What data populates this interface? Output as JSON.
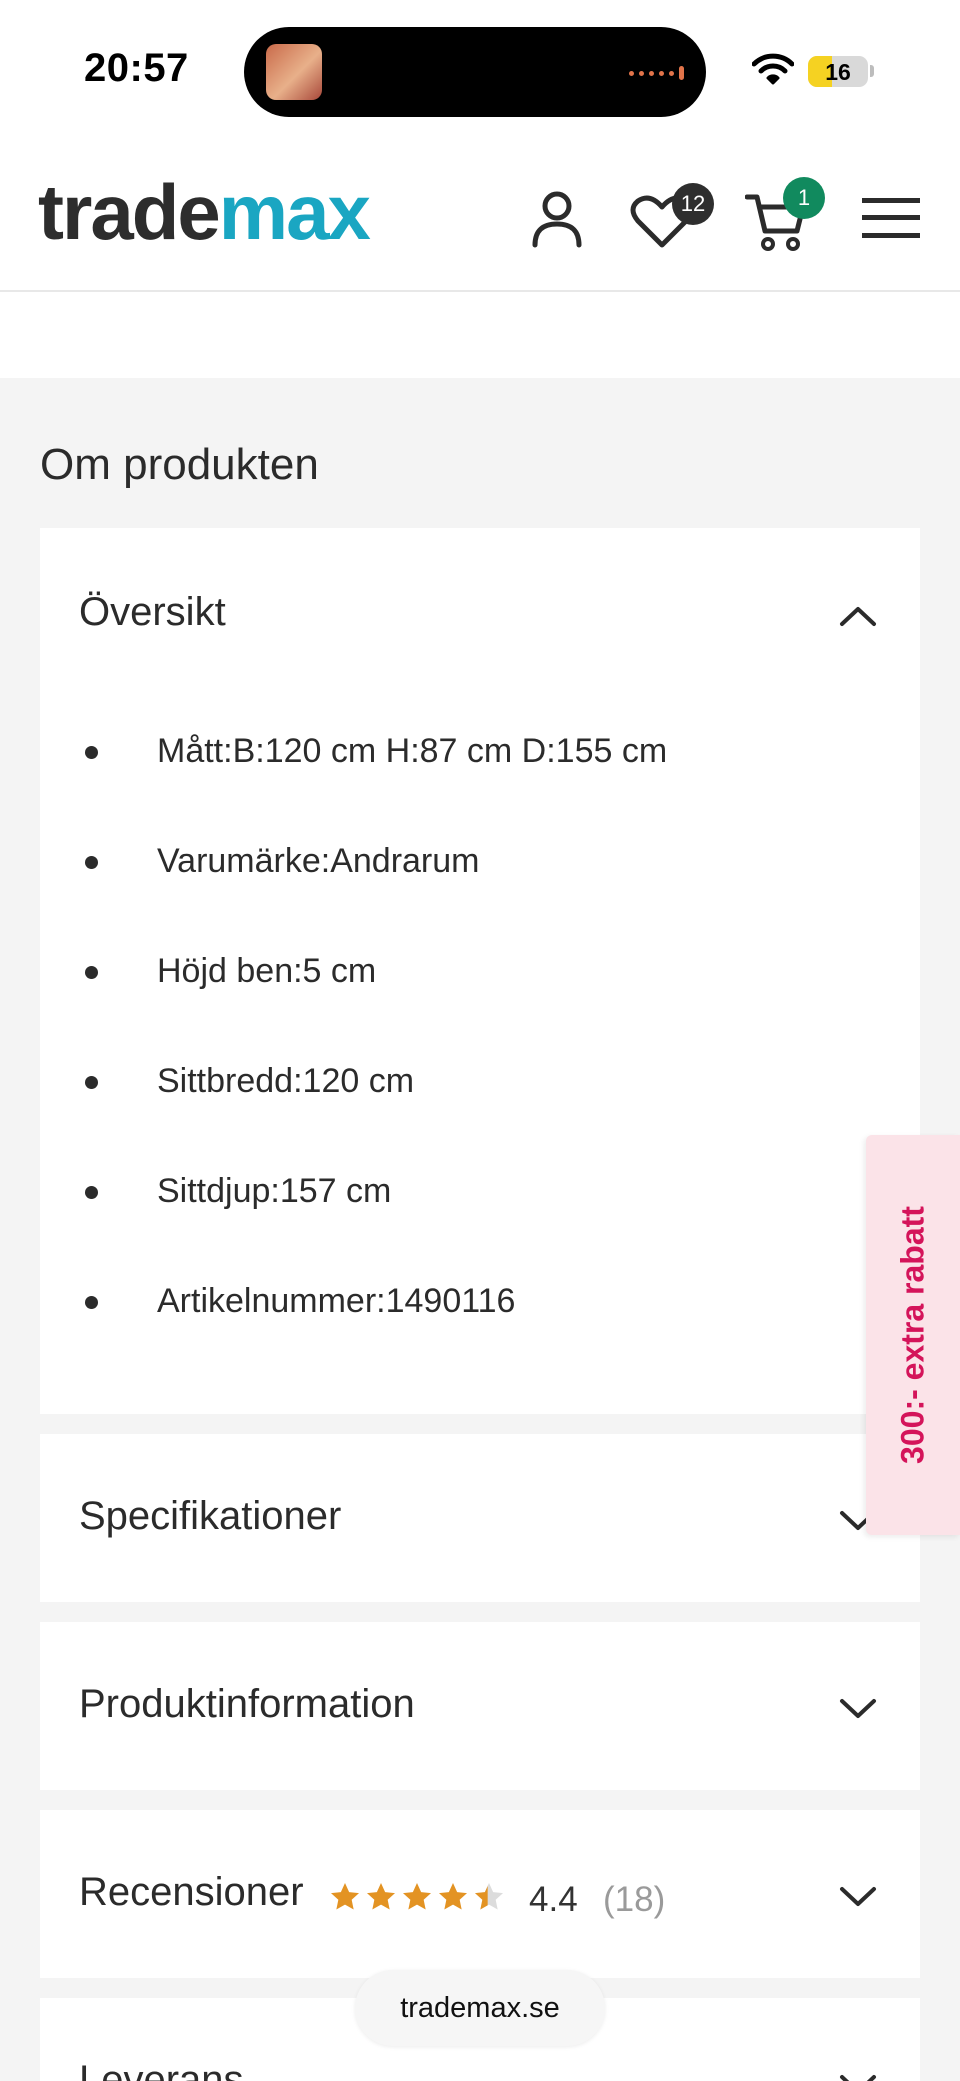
{
  "status_bar": {
    "time": "20:57",
    "battery": "16"
  },
  "header": {
    "logo_part1": "trade",
    "logo_part2": "max",
    "wishlist_count": "12",
    "cart_count": "1"
  },
  "section_title": "Om produkten",
  "overview": {
    "title": "Översikt",
    "items": [
      "Mått:B:120 cm H:87 cm D:155 cm",
      "Varumärke:Andrarum",
      "Höjd ben:5 cm",
      "Sittbredd:120 cm",
      "Sittdjup:157 cm",
      "Artikelnummer:1490116"
    ]
  },
  "accordions": {
    "specifications": "Specifikationer",
    "product_info": "Produktinformation",
    "reviews": "Recensioner",
    "delivery": "Leverans"
  },
  "reviews": {
    "rating": "4.4",
    "count": "(18)",
    "rating_value": 4.4,
    "max_stars": 5
  },
  "promo_tab": "300:- extra rabatt",
  "browser": {
    "url": "trademax.se"
  },
  "colors": {
    "brand_dark": "#2d2d2d",
    "brand_accent": "#1aa6c2",
    "cart_badge": "#118a5e",
    "promo_text": "#d4145a",
    "star": "#e39323"
  }
}
